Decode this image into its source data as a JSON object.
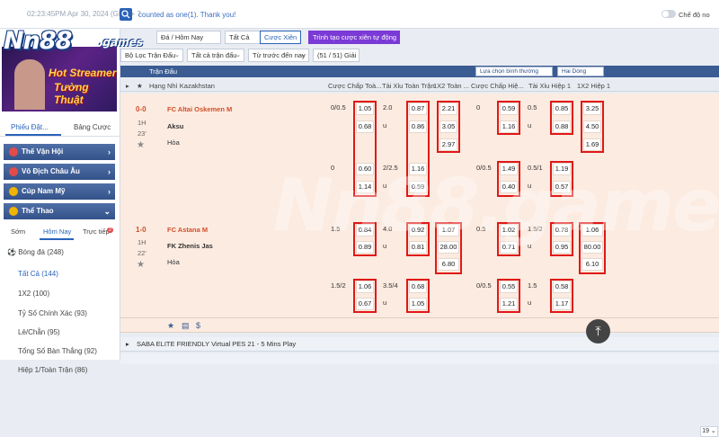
{
  "topbar": {
    "clock": "02:23:45PM Apr 30, 2024 (GMT + 7",
    "announce": "counted as one(1). Thank you!",
    "toggle_label": "Chế độ no"
  },
  "logo": {
    "brand": "Nn88",
    "suffix": ".games"
  },
  "left": {
    "banner_line1": "Hot Streamer",
    "banner_line2": "Tường Thuật",
    "tab1": "Phiếu Đặt...",
    "tab2": "Bảng Cược",
    "menu": [
      {
        "label": "Thế Vận Hội",
        "color": "#e24b4b"
      },
      {
        "label": "Vô Địch Châu Âu",
        "color": "#e24b4b"
      },
      {
        "label": "Cúp Nam Mỹ",
        "color": "#f0b400"
      },
      {
        "label": "Thể Thao",
        "color": "#f0b400"
      }
    ],
    "subtabs": [
      "Sớm",
      "Hôm Nay",
      "Trực tiếp"
    ],
    "badge": "2",
    "sport": "Bóng đá (248)",
    "items": [
      "Tất Cả (144)",
      "1X2 (100)",
      "Tỷ Số Chính Xác (93)",
      "Lẻ/Chẵn (95)",
      "Tổng Số Bàn Thắng (92)",
      "Hiệp 1/Toàn Trận (86)"
    ]
  },
  "toolbar": {
    "date": "Đá / Hôm Nay",
    "all": "Tất Cả",
    "parlay": "Cược Xiên",
    "auto_parlay": "Trình tạo cược xiên tự động",
    "filter_league": "Bộ Lọc Trận Đấu",
    "all_matches": "Tất cả trận đấu",
    "sort": "Từ trước đến nay",
    "count": "(51 / 51) Giải"
  },
  "header": {
    "title": "Trận Đấu",
    "select1": "Lựa chọn bình thường",
    "select2": "Hai Dòng"
  },
  "columns": {
    "league": "Hạng Nhì Kazakhstan",
    "c1": "Cược Chấp Toà...",
    "c2": "Tài Xỉu Toàn Trận",
    "c3": "1X2 Toàn ...",
    "c4": "Cược Chấp Hiệ...",
    "c5": "Tài Xỉu Hiệp 1",
    "c6": "1X2 Hiệp 1"
  },
  "match1": {
    "score": "0-0",
    "half": "1H",
    "min": "23'",
    "home": "FC Altai Oskemen M",
    "away": "Aksu",
    "draw": "Hòa",
    "r1": {
      "hc": "0/0.5",
      "hc_h": "1.05",
      "hc_a": "0.68",
      "ou": "2.0",
      "ou_o": "0.87",
      "u": "u",
      "ou_u": "0.86",
      "x1": "2.21",
      "x2": "3.05",
      "xd": "2.97",
      "hhc": "0",
      "hhc_h": "0.59",
      "hhc_a": "1.16",
      "hou": "0.5",
      "hou_o": "0.85",
      "hu": "u",
      "hou_u": "0.88",
      "hx1": "3.25",
      "hx2": "4.50",
      "hxd": "1.69"
    },
    "r2": {
      "hc": "0",
      "hc_h": "0.60",
      "hc_a": "1.14",
      "ou": "2/2.5",
      "ou_o": "1.16",
      "u": "u",
      "ou_u": "0.59",
      "hhc": "0/0.5",
      "hhc_h": "1.49",
      "hhc_a": "0.40",
      "hou": "0.5/1",
      "hou_o": "1.19",
      "hu": "u",
      "hou_u": "0.57"
    },
    "page": "19"
  },
  "match2": {
    "score": "1-0",
    "half": "1H",
    "min": "22'",
    "home": "FC Astana M",
    "away": "FK Zhenis Jas",
    "draw": "Hòa",
    "r1": {
      "hc": "1.5",
      "hc_h": "0.84",
      "hc_a": "0.89",
      "ou": "4.0",
      "ou_o": "0.92",
      "u": "u",
      "ou_u": "0.81",
      "x1": "1.07",
      "x2": "28.00",
      "xd": "6.80",
      "hhc": "0.5",
      "hhc_h": "1.02",
      "hhc_a": "0.71",
      "hou": "1.5/2",
      "hou_o": "0.78",
      "hu": "u",
      "hou_u": "0.95",
      "hx1": "1.06",
      "hx2": "80.00",
      "hxd": "6.10"
    },
    "r2": {
      "hc": "1.5/2",
      "hc_h": "1.06",
      "hc_a": "0.67",
      "ou": "3.5/4",
      "ou_o": "0.68",
      "u": "u",
      "ou_u": "1.05",
      "hhc": "0/0.5",
      "hhc_h": "0.55",
      "hhc_a": "1.21",
      "hou": "1.5",
      "hou_o": "0.58",
      "hu": "u",
      "hou_u": "1.17"
    }
  },
  "bottom": {
    "league2": "SABA ELITE FRIENDLY Virtual PES 21 - 5 Mins Play"
  }
}
